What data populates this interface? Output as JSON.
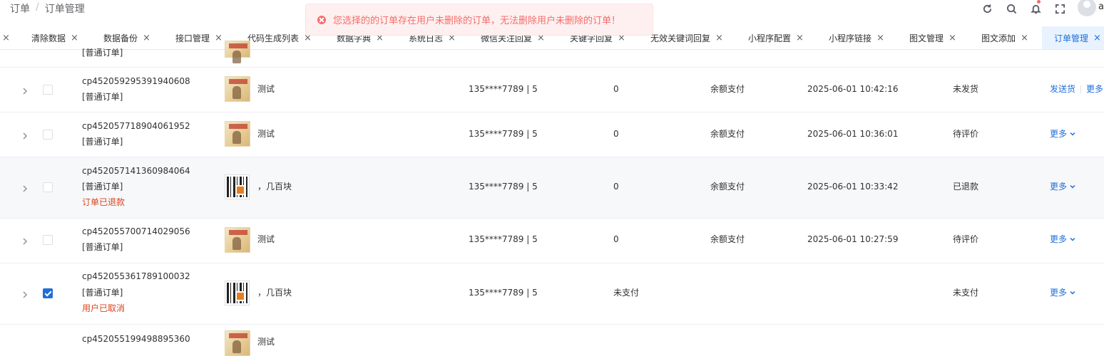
{
  "breadcrumb": {
    "items": [
      "订单",
      "订单管理"
    ],
    "separator": "/"
  },
  "header": {
    "avatar_initial": "a"
  },
  "toast": {
    "type": "error",
    "message": "您选择的的订单存在用户未删除的订单，无法删除用户未删除的订单！"
  },
  "tabs": [
    {
      "label": ""
    },
    {
      "label": "清除数据"
    },
    {
      "label": "数据备份"
    },
    {
      "label": "接口管理"
    },
    {
      "label": "代码生成列表"
    },
    {
      "label": "数据字典"
    },
    {
      "label": "系统日志"
    },
    {
      "label": "微信关注回复"
    },
    {
      "label": "关键字回复"
    },
    {
      "label": "无效关键词回复"
    },
    {
      "label": "小程序配置"
    },
    {
      "label": "小程序链接"
    },
    {
      "label": "图文管理"
    },
    {
      "label": "图文添加"
    },
    {
      "label": "订单管理",
      "active": true
    }
  ],
  "colors": {
    "accent": "#1e6fd9",
    "error": "#f56c6c",
    "refund": "#d9451c"
  },
  "partial_row": {
    "type": "[普通订单]"
  },
  "orders": [
    {
      "order_no": "cp452059295391940608",
      "type": "[普通订单]",
      "note": "",
      "product": "测试",
      "thumb": "book",
      "user": "135****7789 | 5",
      "amount": "0",
      "pay": "余额支付",
      "time": "2025-06-01 10:42:16",
      "status": "未发货",
      "action1": "发送货",
      "action2": "更多",
      "checked": false
    },
    {
      "order_no": "cp452057718904061952",
      "type": "[普通订单]",
      "note": "",
      "product": "测试",
      "thumb": "book",
      "user": "135****7789 | 5",
      "amount": "0",
      "pay": "余额支付",
      "time": "2025-06-01 10:36:01",
      "status": "待评价",
      "action2": "更多",
      "checked": false
    },
    {
      "order_no": "cp452057141360984064",
      "type": "[普通订单]",
      "note": "订单已退款",
      "product": "，几百块",
      "thumb": "qr",
      "user": "135****7789 | 5",
      "amount": "0",
      "pay": "余额支付",
      "time": "2025-06-01 10:33:42",
      "status": "已退款",
      "action2": "更多",
      "checked": false
    },
    {
      "order_no": "cp452055700714029056",
      "type": "[普通订单]",
      "note": "",
      "product": "测试",
      "thumb": "book",
      "user": "135****7789 | 5",
      "amount": "0",
      "pay": "余额支付",
      "time": "2025-06-01 10:27:59",
      "status": "待评价",
      "action2": "更多",
      "checked": false
    },
    {
      "order_no": "cp452055361789100032",
      "type": "[普通订单]",
      "note": "用户已取消",
      "product": "，几百块",
      "thumb": "qr",
      "user": "135****7789 | 5",
      "amount": "未支付",
      "pay": "",
      "time": "",
      "status": "未支付",
      "action2": "更多",
      "checked": true
    },
    {
      "order_no": "cp452055199498895360",
      "type": "",
      "note": "",
      "product": "测试",
      "thumb": "book",
      "user": "",
      "amount": "",
      "pay": "",
      "time": "",
      "status": "",
      "action2": "",
      "checked": false
    }
  ]
}
